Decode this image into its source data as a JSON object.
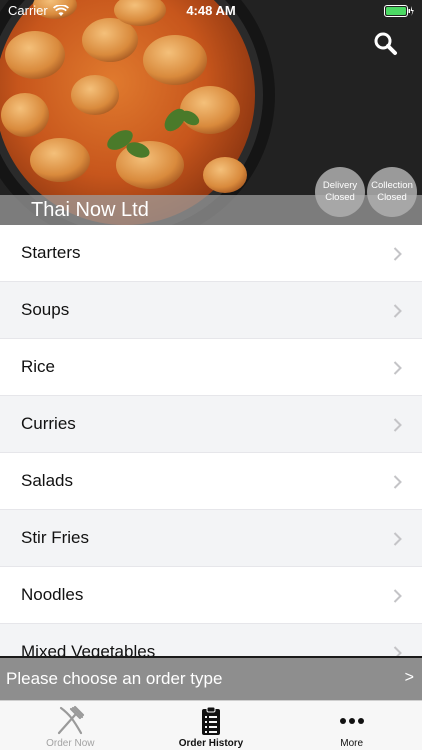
{
  "status_bar": {
    "carrier": "Carrier",
    "time": "4:48 AM"
  },
  "restaurant": {
    "name": "Thai Now Ltd"
  },
  "badges": {
    "delivery": {
      "line1": "Delivery",
      "line2": "Closed"
    },
    "collection": {
      "line1": "Collection",
      "line2": "Closed"
    }
  },
  "menu": {
    "categories": [
      "Starters",
      "Soups",
      "Rice",
      "Curries",
      "Salads",
      "Stir Fries",
      "Noodles",
      "Mixed Vegetables"
    ]
  },
  "order_bar": {
    "text": "Please choose an order type",
    "arrow": ">"
  },
  "tabs": [
    {
      "label": "Order Now",
      "icon": "fork-knife-icon",
      "active": false
    },
    {
      "label": "Order History",
      "icon": "clipboard-list-icon",
      "active": true
    },
    {
      "label": "More",
      "icon": "ellipsis-icon",
      "active": false
    }
  ],
  "colors": {
    "order_bar": "#8e8e8e",
    "band": "#a0a0a0",
    "active_tab": "#111111",
    "inactive_tab": "#a3a3a3"
  }
}
